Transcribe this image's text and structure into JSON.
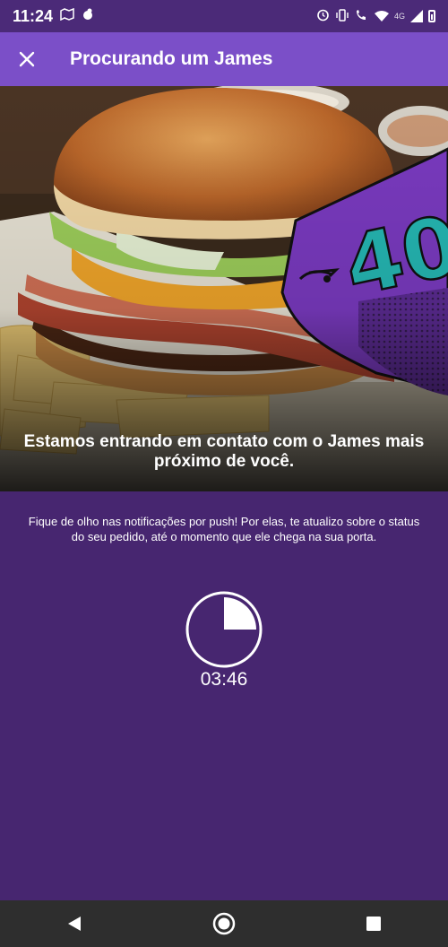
{
  "status_bar": {
    "time": "11:24",
    "network_label": "4G"
  },
  "header": {
    "title": "Procurando um James",
    "close_icon": "close-icon"
  },
  "hero": {
    "caption": "Estamos entrando em contato com o James mais próximo de você.",
    "badge_text": "40"
  },
  "main": {
    "message": "Fique de olho nas notificações por push! Por elas, te atualizo sobre o status do seu pedido, até o momento que ele chega na sua porta.",
    "timer_value": "03:46",
    "timer_progress": 0.25
  },
  "nav": {
    "back_icon": "back-icon",
    "home_icon": "home-icon",
    "recents_icon": "recents-icon"
  },
  "colors": {
    "background": "#472670",
    "app_bar": "#7b4fc8",
    "status_bar": "#4b2a78",
    "badge_purple": "#7a3ac0",
    "badge_teal": "#25b7b3"
  }
}
